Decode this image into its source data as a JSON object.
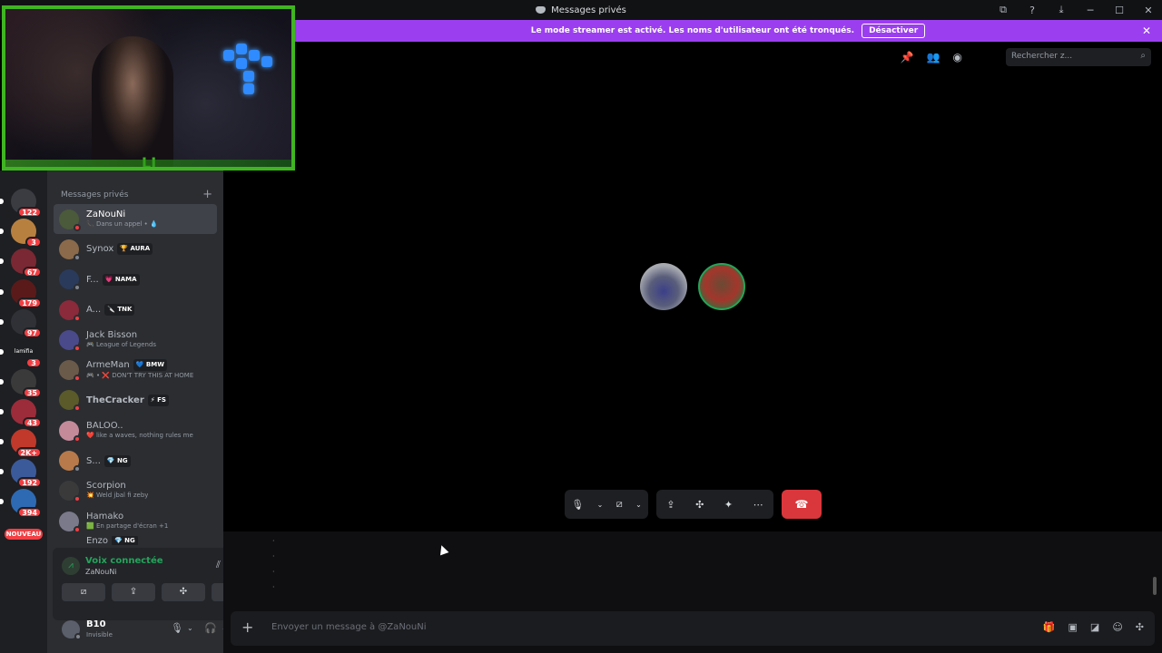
{
  "window": {
    "title": "Messages privés",
    "controls": [
      "─",
      "☐",
      "✕"
    ]
  },
  "banner": {
    "text": "Le mode streamer est activé. Les noms d'utilisateur ont été tronqués.",
    "button": "Désactiver",
    "close": "✕"
  },
  "webcam": {
    "logo": "LJ"
  },
  "servers": [
    {
      "badge": "122",
      "color": "#3a3c42"
    },
    {
      "badge": "3",
      "color": "#b8803f"
    },
    {
      "badge": "67",
      "color": "#7a2833"
    },
    {
      "badge": "179",
      "color": "#5a1a1a"
    },
    {
      "badge": "97",
      "color": "#2f3136"
    },
    {
      "badge": "3",
      "color": "#1e1f22",
      "label": "lamifia"
    },
    {
      "badge": "35",
      "color": "#3a3a3a"
    },
    {
      "badge": "43",
      "color": "#9c2c3a"
    },
    {
      "badge": "2K+",
      "color": "#c0392b"
    },
    {
      "badge": "192",
      "color": "#3b5a9a"
    },
    {
      "badge": "394",
      "color": "#2d6ab3"
    }
  ],
  "nouveau": "NOUVEAU",
  "dm_header": "Messages privés",
  "dm_plus": "+",
  "dms": [
    {
      "name": "ZaNouNi",
      "sub": "📞 Dans un appel • 💧",
      "tag": "",
      "active": true,
      "avatar": "#4a5a3a",
      "status": "#f23f43"
    },
    {
      "name": "Synox",
      "sub": "",
      "tag": "🏆 AURA",
      "avatar": "#8a6a4a",
      "status": "#80848e"
    },
    {
      "name": "F...",
      "sub": "",
      "tag": "💗 NAMA",
      "avatar": "#2a3a5a",
      "status": "#80848e"
    },
    {
      "name": "A...",
      "sub": "",
      "tag": "🔪 TNK",
      "avatar": "#8a2a3a",
      "status": "#f23f43"
    },
    {
      "name": "Jack Bisson",
      "sub": "🎮 League of Legends",
      "tag": "",
      "avatar": "#4a4a8a",
      "status": "#f23f43"
    },
    {
      "name": "ArmeMan",
      "sub": "🎮 • ❌ DON'T TRY THIS AT HOME",
      "tag": "💙 BMW",
      "avatar": "#6a5a4a",
      "status": "#f23f43"
    },
    {
      "name": "TheCracker",
      "sub": "",
      "tag": "⚡ FS",
      "avatar": "#5a5a2a",
      "status": "#f23f43"
    },
    {
      "name": "BALOO..",
      "sub": "❤️ like a waves, nothing rules me",
      "tag": "",
      "avatar": "#c48a9a",
      "status": "#f23f43"
    },
    {
      "name": "S...",
      "sub": "",
      "tag": "💎 NG",
      "avatar": "#b87a4a",
      "status": "#80848e"
    },
    {
      "name": "Scorpion",
      "sub": "💥 Weld jbal fi zeby",
      "tag": "",
      "avatar": "#3a3a3a",
      "status": "#f23f43"
    },
    {
      "name": "Hamako",
      "sub": "🟩 En partage d'écran +1",
      "tag": "",
      "avatar": "#7a7a8a",
      "status": "#f23f43"
    },
    {
      "name": "Enzo",
      "sub": "",
      "tag": "💎 NG",
      "avatar": "#5a4a3a",
      "status": "#80848e"
    }
  ],
  "voice": {
    "title": "Voix connectée",
    "channel": "ZaNouNi",
    "buttons": [
      "⧄",
      "⇪",
      "✣",
      "✦"
    ]
  },
  "user": {
    "name": "B10",
    "status": "Invisible"
  },
  "search": {
    "placeholder": "Rechercher z..."
  },
  "composer": {
    "placeholder": "Envoyer un message à @ZaNouNi"
  },
  "colors": {
    "banner": "#9b3ef0",
    "webcam_border": "#3fb522",
    "hangup": "#da373c",
    "voice_green": "#23a55a"
  }
}
